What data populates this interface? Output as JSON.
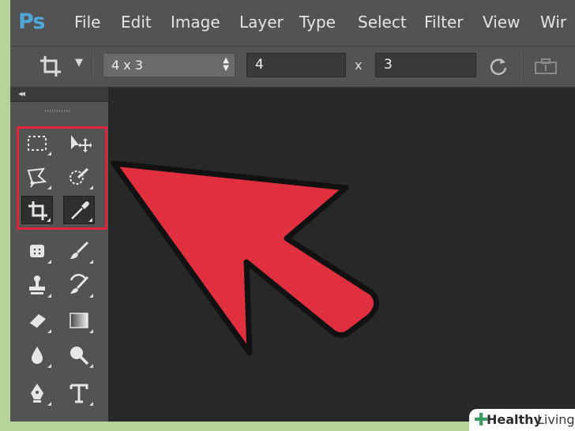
{
  "app": {
    "logo": "Ps"
  },
  "menu": [
    "File",
    "Edit",
    "Image",
    "Layer",
    "Type",
    "Select",
    "Filter",
    "View",
    "Wir"
  ],
  "options_bar": {
    "preset_value": "4 x 3",
    "width_value": "4",
    "separator": "x",
    "height_value": "3"
  },
  "tools_panel": {
    "collapse_glyph": "◂◂",
    "tools": [
      "rectangular-marquee-icon",
      "move-icon",
      "polygonal-lasso-icon",
      "quick-selection-icon",
      "crop-icon",
      "eyedropper-icon",
      "spot-healing-icon",
      "brush-icon",
      "clone-stamp-icon",
      "history-brush-icon",
      "eraser-icon",
      "gradient-icon",
      "blur-icon",
      "dodge-icon",
      "pen-icon",
      "type-icon"
    ]
  },
  "colors": {
    "highlight": "#e4253f",
    "arrow": "#e0303f",
    "ui_gray": "#535353"
  },
  "watermark": {
    "brand_bold": "Healthy",
    "brand_light": "Living"
  }
}
